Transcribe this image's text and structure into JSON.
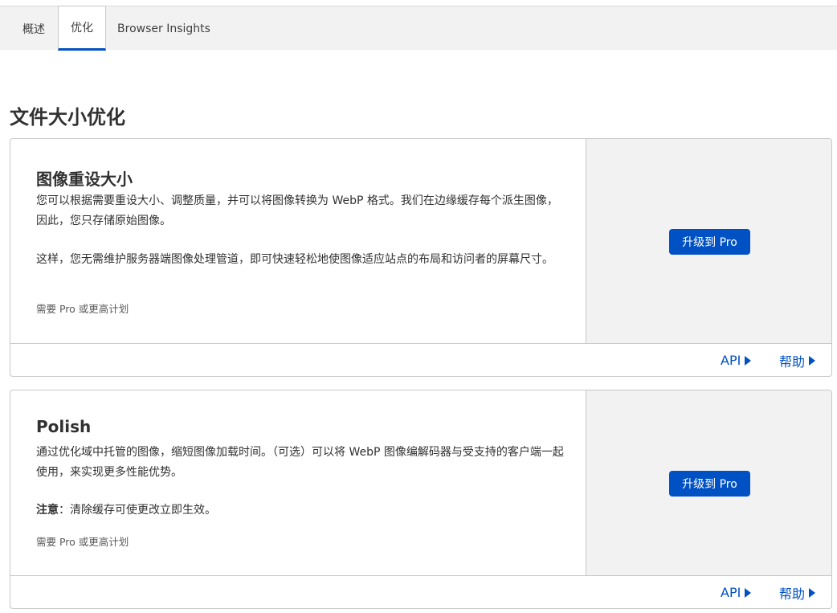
{
  "tabs": [
    {
      "label": "概述"
    },
    {
      "label": "优化"
    },
    {
      "label": "Browser Insights"
    }
  ],
  "section_title": "文件大小优化",
  "cards": [
    {
      "title": "图像重设大小",
      "paragraph1": "您可以根据需要重设大小、调整质量，并可以将图像转换为 WebP 格式。我们在边缘缓存每个派生图像，因此，您只存储原始图像。",
      "paragraph2": "这样，您无需维护服务器端图像处理管道，即可快速轻松地使图像适应站点的布局和访问者的屏幕尺寸。",
      "requirement": "需要 Pro 或更高计划",
      "button_label": "升级到 Pro",
      "api_label": "API",
      "help_label": "帮助"
    },
    {
      "title": "Polish",
      "paragraph1": "通过优化域中托管的图像，缩短图像加载时间。（可选）可以将 WebP 图像编解码器与受支持的客户端一起使用，来实现更多性能优势。",
      "note_label": "注意",
      "note_text": "：清除缓存可使更改立即生效。",
      "requirement": "需要 Pro 或更高计划",
      "button_label": "升级到 Pro",
      "api_label": "API",
      "help_label": "帮助"
    }
  ],
  "colors": {
    "accent": "#0051c3",
    "side_panel": "#f2f2f2",
    "border": "#c8c8c8"
  },
  "icons": {
    "link_arrow": "caret-right-icon"
  }
}
